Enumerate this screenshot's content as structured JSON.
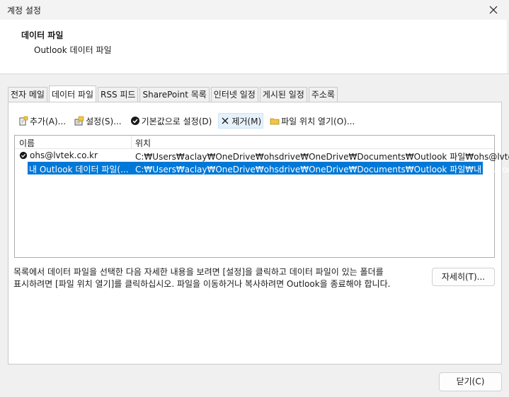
{
  "window": {
    "title": "계정 설정"
  },
  "header": {
    "title": "데이터 파일",
    "subtitle": "Outlook 데이터 파일"
  },
  "tabs": [
    {
      "label": "전자 메일",
      "active": false
    },
    {
      "label": "데이터 파일",
      "active": true
    },
    {
      "label": "RSS 피드",
      "active": false
    },
    {
      "label": "SharePoint 목록",
      "active": false
    },
    {
      "label": "인터넷 일정",
      "active": false
    },
    {
      "label": "게시된 일정",
      "active": false
    },
    {
      "label": "주소록",
      "active": false
    }
  ],
  "toolbar": {
    "add_label": "추가(A)...",
    "settings_label": "설정(S)...",
    "default_label": "기본값으로 설정(D)",
    "remove_label": "제거(M)",
    "open_location_label": "파일 위치 열기(O)..."
  },
  "list": {
    "columns": {
      "name": "이름",
      "location": "위치"
    },
    "rows": [
      {
        "name": "ohs@lvtek.co.kr",
        "location": "C:₩Users₩aclay₩OneDrive₩ohsdrive₩OneDrive₩Documents₩Outlook 파일₩ohs@lvtek...",
        "is_default": true,
        "selected": false
      },
      {
        "name": "내 Outlook 데이터 파일(...",
        "location": "C:₩Users₩aclay₩OneDrive₩ohsdrive₩OneDrive₩Documents₩Outlook 파일₩내 Outloo...",
        "is_default": false,
        "selected": true
      }
    ]
  },
  "description": {
    "line1": "목록에서 데이터 파일을 선택한 다음 자세한 내용을 보려면 [설정]을 클릭하고 데이터 파일이 있는 폴더를",
    "line2": "표시하려면 [파일 위치 열기]를 클릭하십시오. 파일을 이동하거나 복사하려면 Outlook을 종료해야 합니다."
  },
  "buttons": {
    "details": "자세히(T)...",
    "close": "닫기(C)"
  },
  "colors": {
    "selection": "#0078d7",
    "hover": "#e5f1fb",
    "background": "#f0f0f0"
  }
}
